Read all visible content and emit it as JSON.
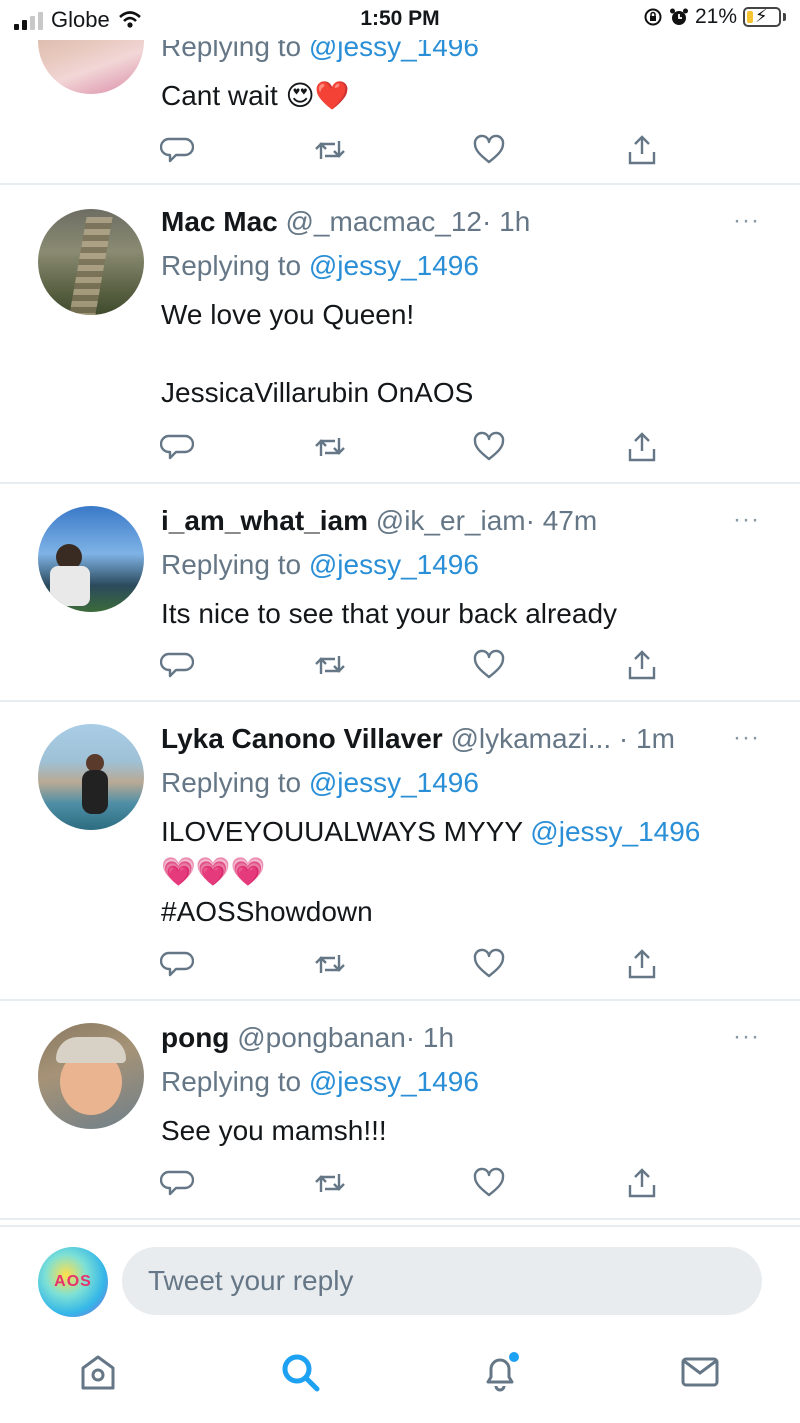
{
  "status_bar": {
    "carrier": "Globe",
    "time": "1:50 PM",
    "battery": "21%",
    "battery_level": 0.21
  },
  "tweets": [
    {
      "replying_prefix": "Replying to",
      "replying_handle": "@jessy_1496",
      "text": "Cant wait 😍❤️"
    },
    {
      "name": "Mac Mac",
      "handle": "@_macmac_12",
      "time": "· 1h",
      "replying_prefix": "Replying to",
      "replying_handle": "@jessy_1496",
      "line1": "We love you Queen!",
      "line2": "JessicaVillarubin OnAOS"
    },
    {
      "name": "i_am_what_iam",
      "handle": "@ik_er_iam",
      "time": "· 47m",
      "replying_prefix": "Replying to",
      "replying_handle": "@jessy_1496",
      "text": "Its nice to see that your back already"
    },
    {
      "name": "Lyka Canono Villaver",
      "handle": "@lykamazi...",
      "time": "· 1m",
      "replying_prefix": "Replying to",
      "replying_handle": "@jessy_1496",
      "text": "ILOVEYOUUALWAYS MYYY",
      "mention": "@jessy_1496",
      "emojis": "💗💗💗",
      "hashtag": "#AOSShowdown"
    },
    {
      "name": "pong",
      "handle": "@pongbanan",
      "time": "· 1h",
      "replying_prefix": "Replying to",
      "replying_handle": "@jessy_1496",
      "text": "See you mamsh!!!"
    }
  ],
  "more_label": "···",
  "reply_bar": {
    "avatar_text": "AOS",
    "placeholder": "Tweet your reply"
  },
  "colors": {
    "accent": "#1da1f2",
    "text_secondary": "#657786",
    "divider": "#e6ecf0"
  }
}
